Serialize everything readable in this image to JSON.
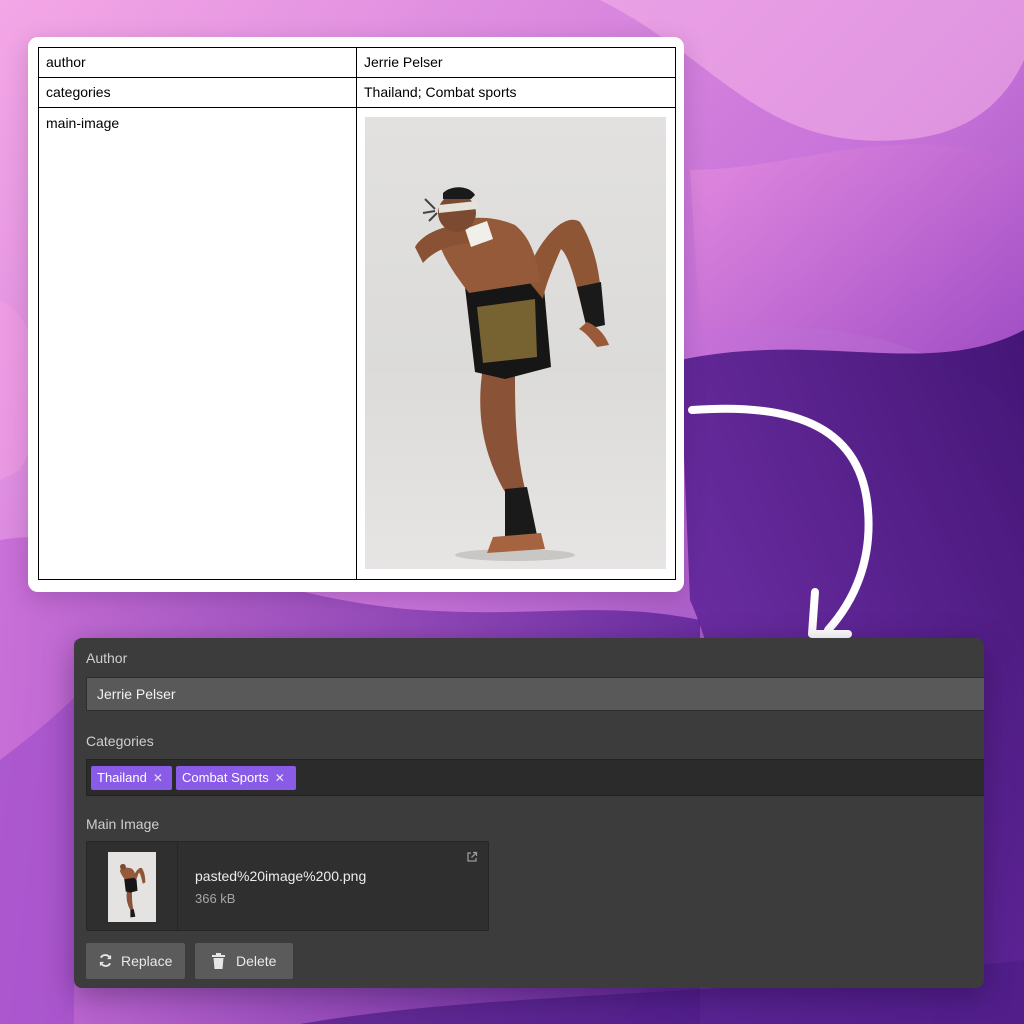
{
  "document": {
    "rows": [
      {
        "key": "author",
        "value": "Jerrie Pelser"
      },
      {
        "key": "categories",
        "value": "Thailand; Combat sports"
      },
      {
        "key": "main-image",
        "value": ""
      }
    ]
  },
  "cms": {
    "author": {
      "label": "Author",
      "value": "Jerrie Pelser"
    },
    "categories": {
      "label": "Categories",
      "tags": [
        {
          "label": "Thailand",
          "remove": "✕"
        },
        {
          "label": "Combat Sports",
          "remove": "✕"
        }
      ]
    },
    "main_image": {
      "label": "Main Image",
      "file_name": "pasted%20image%200.png",
      "file_size": "366 kB"
    },
    "buttons": {
      "replace": "Replace",
      "delete": "Delete"
    }
  },
  "colors": {
    "tag_bg": "#8a5be6",
    "panel_bg": "#3c3c3c",
    "background_accent": "#b45cc8"
  },
  "icons": [
    "refresh-icon",
    "trash-icon",
    "external-link-icon",
    "curved-arrow-icon"
  ]
}
